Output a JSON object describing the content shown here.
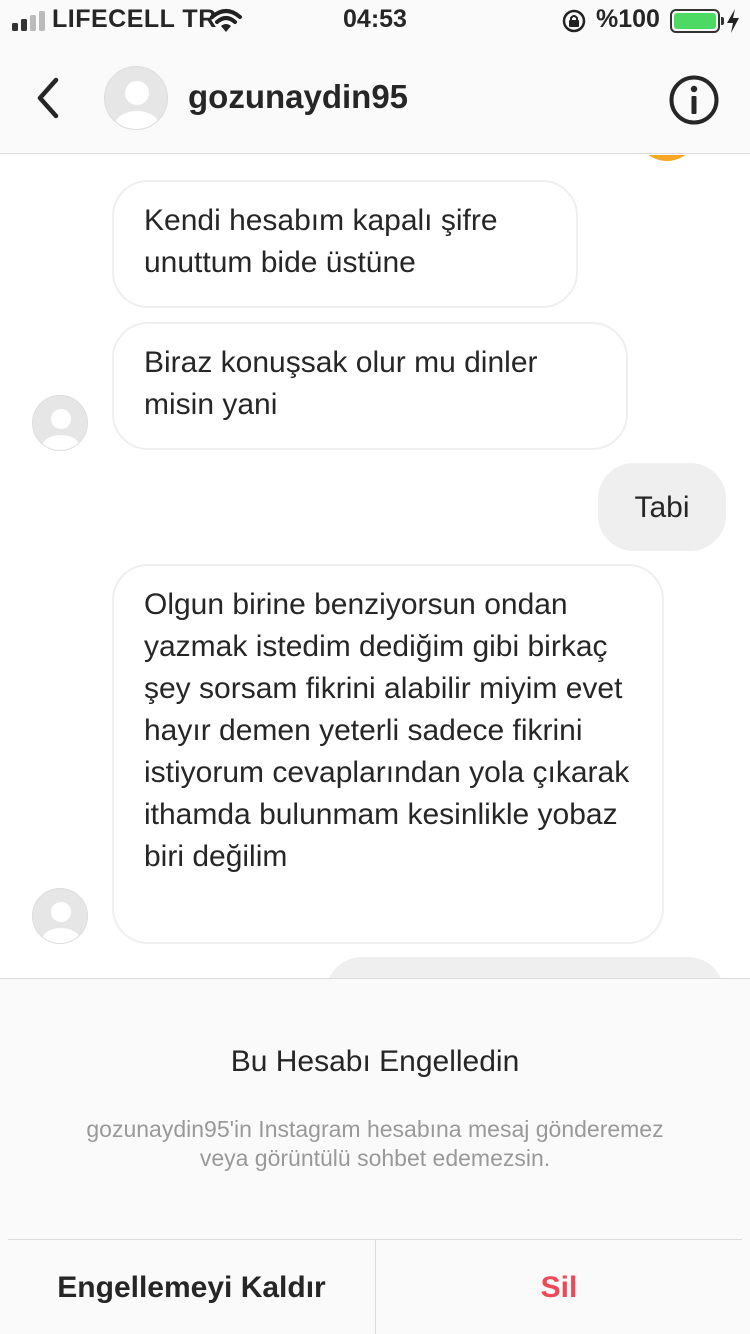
{
  "status_bar": {
    "carrier": "LIFECELL TR",
    "time": "04:53",
    "battery_text": "%100",
    "battery_level": 1.0
  },
  "header": {
    "username": "gozunaydin95",
    "back_icon": "chevron-left-icon",
    "info_icon": "info-circle-icon"
  },
  "messages": [
    {
      "sender": "them",
      "text": "Kendi hesabım kapalı şifre unuttum bide  üstüne"
    },
    {
      "sender": "them",
      "text": "Biraz konuşsak olur mu dinler misin yani"
    },
    {
      "sender": "me",
      "text": "Tabi"
    },
    {
      "sender": "them",
      "text": "Olgun birine benziyorsun ondan yazmak istedim dediğim gibi birkaç şey sorsam fikrini alabilir miyim evet hayır demen yeterli sadece fikrini istiyorum cevaplarından yola çıkarak ithamda bulunmam kesinlikle yobaz biri değilim"
    },
    {
      "sender": "me",
      "text": ""
    }
  ],
  "blocked_panel": {
    "title": "Bu Hesabı Engelledin",
    "description": "gozunaydin95'in Instagram hesabına mesaj gönderemez veya görüntülü sohbet edemezsin.",
    "unblock_label": "Engellemeyi Kaldır",
    "delete_label": "Sil"
  },
  "colors": {
    "accent_red": "#ed4956",
    "bubble_me": "#efefef",
    "battery_green": "#4cd964"
  }
}
